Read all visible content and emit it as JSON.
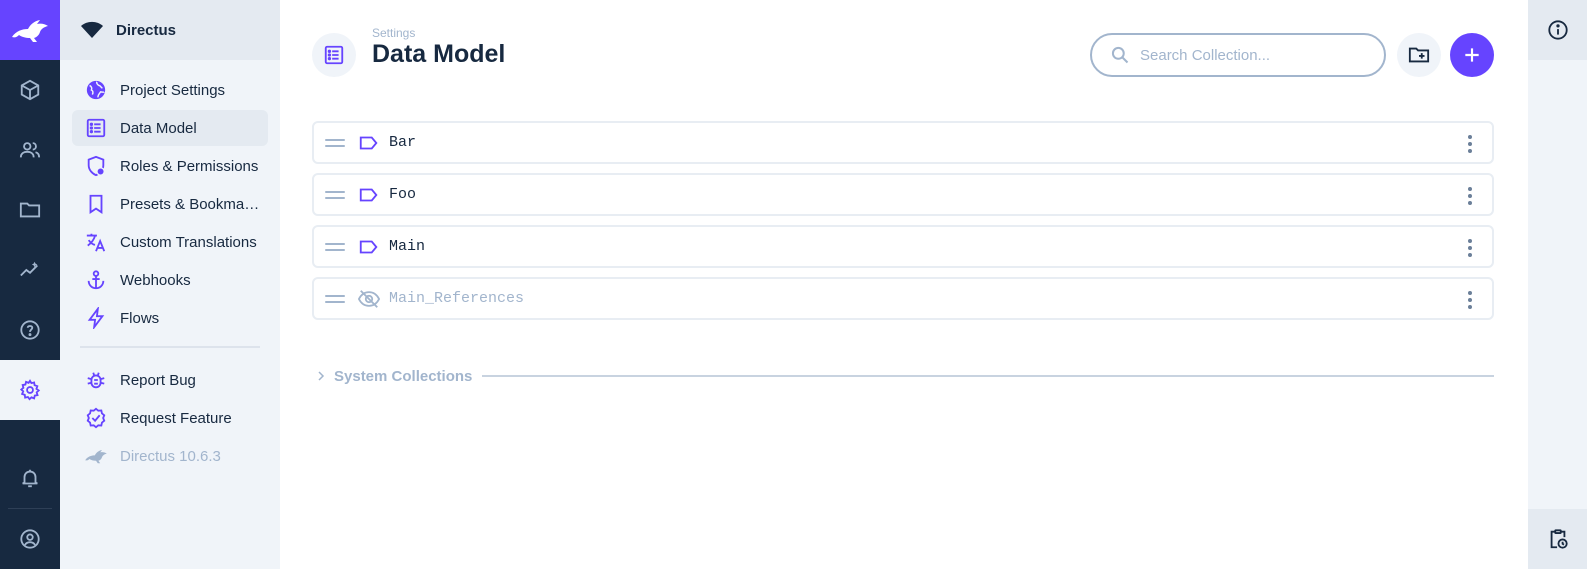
{
  "colors": {
    "accent": "#6644ff",
    "module_bg": "#172940",
    "nav_bg": "#f0f4f9",
    "muted": "#a2b5cd"
  },
  "module_bar": {
    "items": [
      {
        "icon": "cube-icon"
      },
      {
        "icon": "users-icon"
      },
      {
        "icon": "folder-icon"
      },
      {
        "icon": "insights-icon"
      },
      {
        "icon": "help-icon"
      },
      {
        "icon": "gear-icon",
        "active": true
      }
    ],
    "bottom": [
      {
        "icon": "bell-icon"
      },
      {
        "icon": "account-icon"
      }
    ]
  },
  "nav": {
    "project_name": "Directus",
    "items": [
      {
        "label": "Project Settings",
        "icon": "globe-icon"
      },
      {
        "label": "Data Model",
        "icon": "list-alt-icon",
        "active": true
      },
      {
        "label": "Roles & Permissions",
        "icon": "shield-icon"
      },
      {
        "label": "Presets & Bookmarks",
        "icon": "bookmark-icon"
      },
      {
        "label": "Custom Translations",
        "icon": "translate-icon"
      },
      {
        "label": "Webhooks",
        "icon": "anchor-icon"
      },
      {
        "label": "Flows",
        "icon": "bolt-icon"
      }
    ],
    "secondary": [
      {
        "label": "Report Bug",
        "icon": "bug-icon"
      },
      {
        "label": "Request Feature",
        "icon": "verified-icon"
      },
      {
        "label": "Directus 10.6.3",
        "icon": "rabbit-icon"
      }
    ]
  },
  "header": {
    "breadcrumb": "Settings",
    "title": "Data Model",
    "search_placeholder": "Search Collection..."
  },
  "collections": [
    {
      "name": "Bar",
      "hidden": false
    },
    {
      "name": "Foo",
      "hidden": false
    },
    {
      "name": "Main",
      "hidden": false
    },
    {
      "name": "Main_References",
      "hidden": true
    }
  ],
  "system_collections_label": "System Collections"
}
